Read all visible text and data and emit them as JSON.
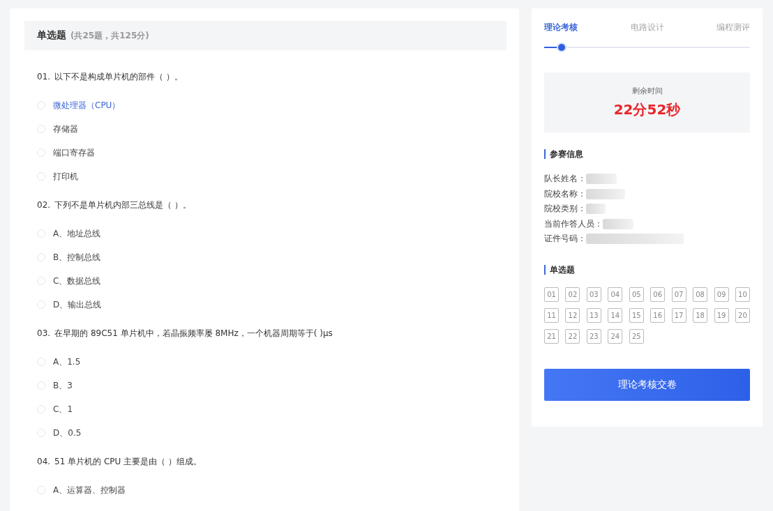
{
  "section": {
    "title": "单选题",
    "summary": "(共25题，共125分)"
  },
  "questions": [
    {
      "number": "01.",
      "text": "以下不是构成单片机的部件（ ）。",
      "options": [
        {
          "label": "微处理器（CPU）",
          "highlighted": true,
          "selected": false
        },
        {
          "label": "存储器",
          "highlighted": false,
          "selected": false
        },
        {
          "label": "端口寄存器",
          "highlighted": false,
          "selected": false
        },
        {
          "label": "打印机",
          "highlighted": false,
          "selected": false
        }
      ]
    },
    {
      "number": "02.",
      "text": "下列不是单片机内部三总线是（ ）。",
      "options": [
        {
          "label": "A、地址总线",
          "highlighted": false,
          "selected": false
        },
        {
          "label": "B、控制总线",
          "highlighted": false,
          "selected": false
        },
        {
          "label": "C、数据总线",
          "highlighted": false,
          "selected": false
        },
        {
          "label": "D、输出总线",
          "highlighted": false,
          "selected": false
        }
      ]
    },
    {
      "number": "03.",
      "text": "在早期的 89C51 单片机中，若晶振频率屡 8MHz，一个机器周期等于( )μs",
      "options": [
        {
          "label": "A、1.5",
          "highlighted": false,
          "selected": false
        },
        {
          "label": "B、3",
          "highlighted": false,
          "selected": false
        },
        {
          "label": "C、1",
          "highlighted": false,
          "selected": false
        },
        {
          "label": "D、0.5",
          "highlighted": false,
          "selected": false
        }
      ]
    },
    {
      "number": "04.",
      "text": "51 单片机的 CPU 主要是由（ ）组成。",
      "options": [
        {
          "label": "A、运算器、控制器",
          "highlighted": false,
          "selected": false
        }
      ]
    }
  ],
  "steps": {
    "items": [
      {
        "label": "理论考核",
        "selected": true
      },
      {
        "label": "电路设计",
        "selected": false
      },
      {
        "label": "编程测评",
        "selected": false
      }
    ],
    "level": 0.085
  },
  "timer": {
    "label": "剩余时间",
    "value": "22分52秒"
  },
  "info": {
    "title": "参赛信息",
    "fields": [
      {
        "label": "队长姓名："
      },
      {
        "label": "院校名称："
      },
      {
        "label": "院校类别："
      },
      {
        "label": "当前作答人员："
      },
      {
        "label": "证件号码："
      }
    ]
  },
  "answer_sheet": {
    "title": "单选题",
    "numbers": [
      "01",
      "02",
      "03",
      "04",
      "05",
      "06",
      "07",
      "08",
      "09",
      "10",
      "11",
      "12",
      "13",
      "14",
      "15",
      "16",
      "17",
      "18",
      "19",
      "20",
      "21",
      "22",
      "23",
      "24",
      "25"
    ]
  },
  "submit_button": "理论考核交卷"
}
